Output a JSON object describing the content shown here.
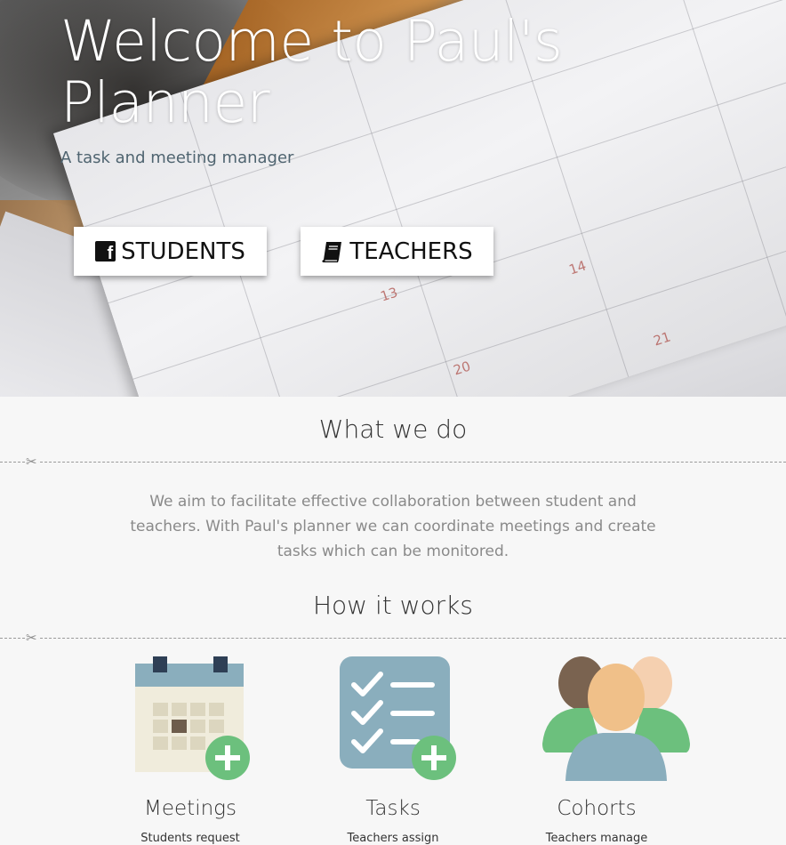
{
  "hero": {
    "title": "Welcome to Paul's Planner",
    "subtitle": "A task and meeting manager",
    "buttons": [
      {
        "label": "STUDENTS",
        "icon": "facebook-icon"
      },
      {
        "label": "TEACHERS",
        "icon": "book-icon"
      }
    ],
    "day_numbers": [
      "13",
      "14",
      "20",
      "21"
    ]
  },
  "what_we_do": {
    "heading": "What we do",
    "text": "We aim to facilitate effective collaboration between student and teachers. With Paul's planner we can coordinate meetings and create tasks which can be monitored."
  },
  "how_it_works": {
    "heading": "How it works",
    "features": [
      {
        "title": "Meetings",
        "desc": "Students request",
        "icon": "calendar-add-icon"
      },
      {
        "title": "Tasks",
        "desc": "Teachers assign",
        "icon": "checklist-add-icon"
      },
      {
        "title": "Cohorts",
        "desc": "Teachers manage",
        "icon": "group-icon"
      }
    ]
  },
  "colors": {
    "calendar_bar": "#8aaebd",
    "calendar_bg": "#f0ecdc",
    "plus_green": "#6cc07d",
    "checklist_bg": "#8aaebd",
    "people_skin": "#f0c089"
  }
}
